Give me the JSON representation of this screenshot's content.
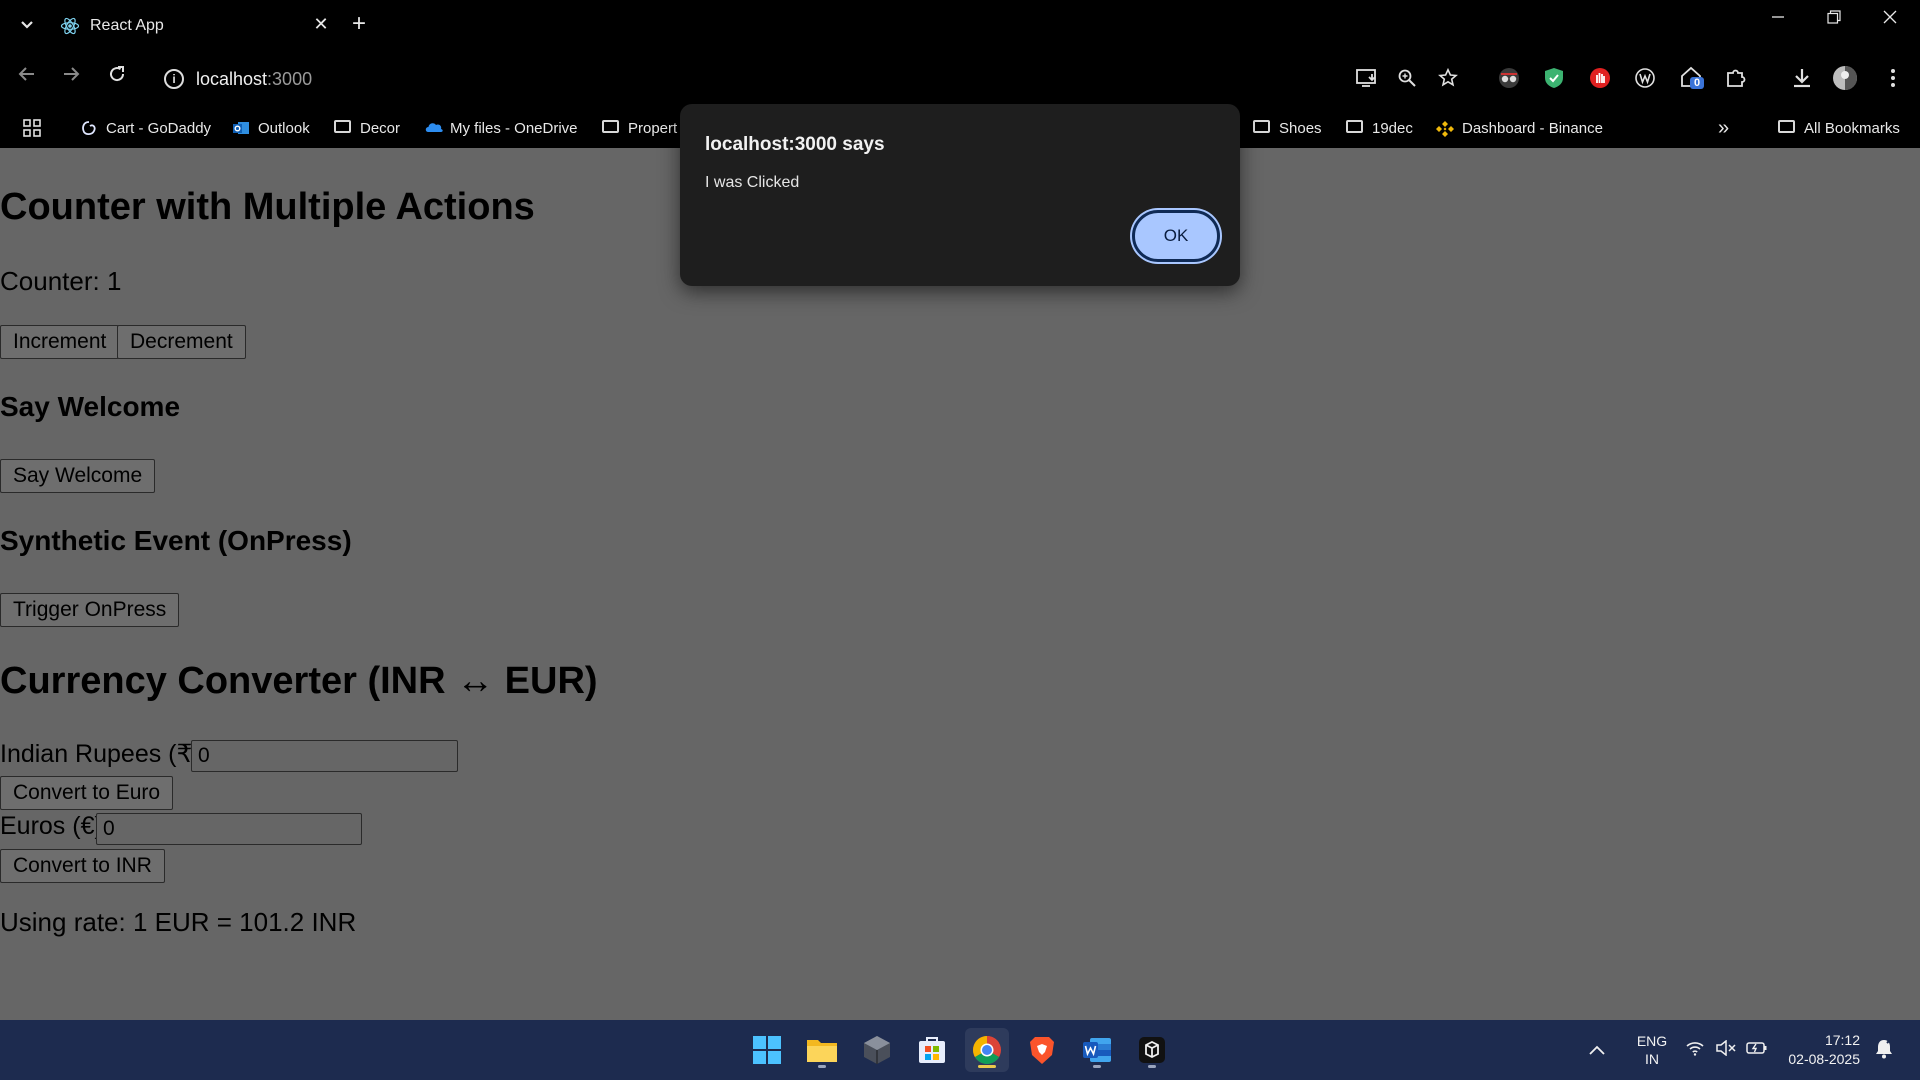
{
  "browser": {
    "tab": {
      "title": "React App"
    },
    "address": {
      "host": "localhost",
      "port": ":3000"
    },
    "bookmarks": [
      {
        "label": "Cart - GoDaddy",
        "icon": "godaddy-icon"
      },
      {
        "label": "Outlook",
        "icon": "outlook-icon"
      },
      {
        "label": "Decor",
        "icon": "folder-icon"
      },
      {
        "label": "My files - OneDrive",
        "icon": "onedrive-icon"
      },
      {
        "label": "Propert",
        "icon": "folder-icon"
      },
      {
        "label": "Shoes",
        "icon": "folder-icon"
      },
      {
        "label": "19dec",
        "icon": "folder-icon"
      },
      {
        "label": "Dashboard - Binance",
        "icon": "binance-icon"
      }
    ],
    "all_bookmarks": "All Bookmarks",
    "extension_badge": "0"
  },
  "page": {
    "title": "Counter with Multiple Actions",
    "counter_text": "Counter: 1",
    "increment_label": "Increment",
    "decrement_label": "Decrement",
    "welcome_heading": "Say Welcome",
    "welcome_button": "Say Welcome",
    "synthetic_heading": "Synthetic Event (OnPress)",
    "trigger_button": "Trigger OnPress",
    "currency_heading": "Currency Converter (INR ↔ EUR)",
    "inr_label": "Indian Rupees (₹)",
    "inr_value": "0",
    "convert_to_euro": "Convert to Euro",
    "eur_label": "Euros (€)",
    "eur_value": "0",
    "convert_to_inr": "Convert to INR",
    "rate_text": "Using rate: 1 EUR = 101.2 INR"
  },
  "dialog": {
    "title": "localhost:3000 says",
    "message": "I was Clicked",
    "ok_label": "OK"
  },
  "taskbar": {
    "lang_top": "ENG",
    "lang_bottom": "IN",
    "time": "17:12",
    "date": "02-08-2025"
  },
  "colors": {
    "page_background": "#666666",
    "dialog_background": "#1e1e1e",
    "ok_button": "#a9c7ff",
    "taskbar": "#1d2b4f"
  }
}
